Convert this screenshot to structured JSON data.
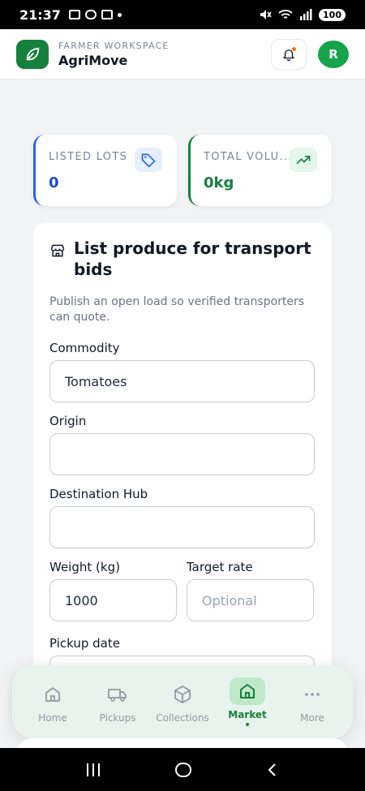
{
  "status_bar": {
    "time": "21:37",
    "battery": "100"
  },
  "header": {
    "subtitle": "FARMER WORKSPACE",
    "title": "AgriMove",
    "avatar_initial": "R"
  },
  "stats": [
    {
      "label": "LISTED LOTS",
      "value": "0",
      "icon": "tag-icon",
      "accent": "#2563eb"
    },
    {
      "label": "TOTAL VOLU...",
      "value": "0kg",
      "icon": "trending-up-icon",
      "accent": "#15803d"
    }
  ],
  "form": {
    "title": "List produce for transport bids",
    "description": "Publish an open load so verified transporters can quote.",
    "commodity": {
      "label": "Commodity",
      "value": "Tomatoes"
    },
    "origin": {
      "label": "Origin",
      "value": ""
    },
    "destination": {
      "label": "Destination Hub",
      "value": ""
    },
    "weight": {
      "label": "Weight (kg)",
      "value": "1000"
    },
    "target_rate": {
      "label": "Target rate",
      "placeholder": "Optional"
    },
    "pickup_date": {
      "label": "Pickup date"
    }
  },
  "nav": [
    {
      "label": "Home",
      "icon": "home-icon",
      "active": false
    },
    {
      "label": "Pickups",
      "icon": "truck-icon",
      "active": false
    },
    {
      "label": "Collections",
      "icon": "box-icon",
      "active": false
    },
    {
      "label": "Market",
      "icon": "market-icon",
      "active": true
    },
    {
      "label": "More",
      "icon": "more-icon",
      "active": false
    }
  ],
  "colors": {
    "brand": "#15803d",
    "active_nav_bg": "#bfe8ca",
    "lots_accent": "#2563eb"
  }
}
